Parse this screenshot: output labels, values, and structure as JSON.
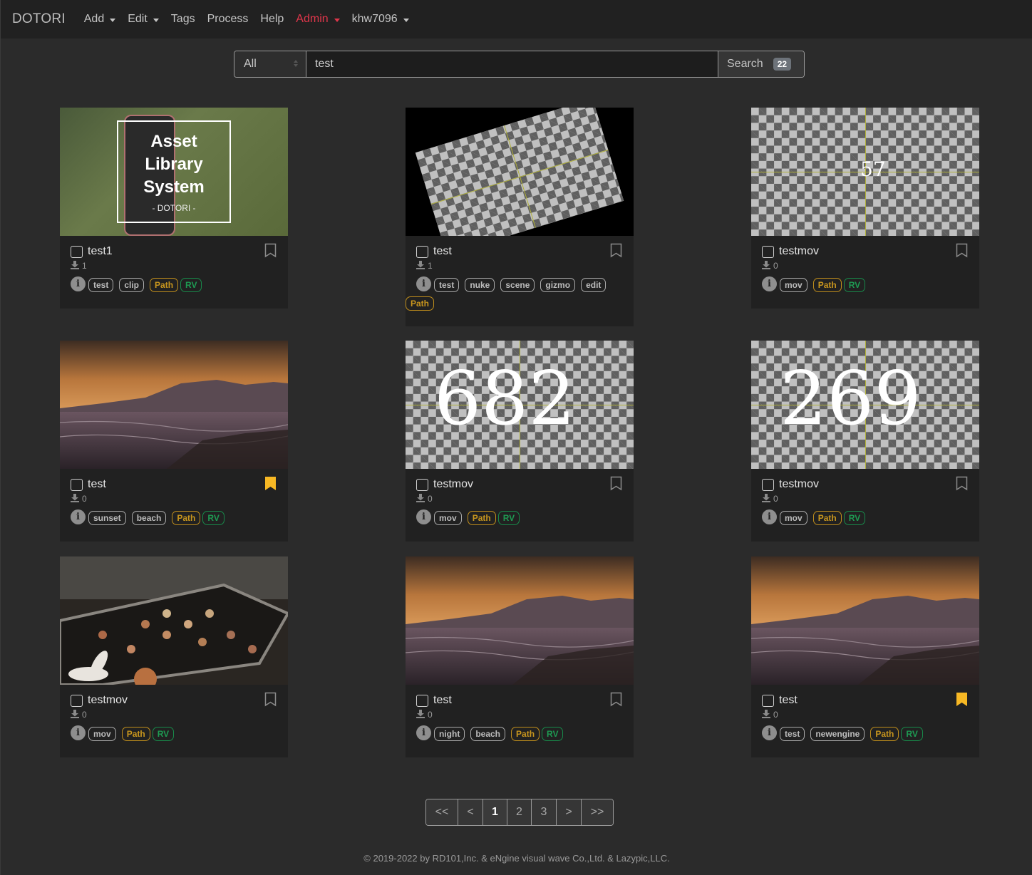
{
  "nav": {
    "brand": "DOTORI",
    "items": [
      {
        "label": "Add",
        "dropdown": true
      },
      {
        "label": "Edit",
        "dropdown": true
      },
      {
        "label": "Tags",
        "dropdown": false
      },
      {
        "label": "Process",
        "dropdown": false
      },
      {
        "label": "Help",
        "dropdown": false
      },
      {
        "label": "Admin",
        "dropdown": true,
        "color": "#e0364b"
      },
      {
        "label": "khw7096",
        "dropdown": true
      }
    ]
  },
  "search": {
    "scope": "All",
    "query": "test",
    "button_label": "Search",
    "result_count": "22"
  },
  "cards": [
    {
      "title": "test1",
      "downloads": "1",
      "bookmarked": false,
      "thumb": "Asset Library System poster",
      "thumb_text": [
        "Asset",
        "Library",
        "System",
        "- DOTORI -"
      ],
      "tags": [
        "test",
        "clip"
      ],
      "path": "Path",
      "rv": "RV"
    },
    {
      "title": "test",
      "downloads": "1",
      "bookmarked": false,
      "thumb": "rotated checkerboard",
      "tags": [
        "test",
        "nuke",
        "scene",
        "gizmo",
        "edit"
      ],
      "path": "Path",
      "rv": null
    },
    {
      "title": "testmov",
      "downloads": "0",
      "bookmarked": false,
      "thumb": "checkerboard frame",
      "frame_number": "57",
      "tags": [
        "mov"
      ],
      "path": "Path",
      "rv": "RV"
    },
    {
      "title": "test",
      "downloads": "0",
      "bookmarked": true,
      "thumb": "sunset beach",
      "tags": [
        "sunset",
        "beach"
      ],
      "path": "Path",
      "rv": "RV"
    },
    {
      "title": "testmov",
      "downloads": "0",
      "bookmarked": false,
      "thumb": "checkerboard frame",
      "frame_number": "682",
      "tags": [
        "mov"
      ],
      "path": "Path",
      "rv": "RV"
    },
    {
      "title": "testmov",
      "downloads": "0",
      "bookmarked": false,
      "thumb": "checkerboard frame",
      "frame_number": "269",
      "tags": [
        "mov"
      ],
      "path": "Path",
      "rv": "RV"
    },
    {
      "title": "testmov",
      "downloads": "0",
      "bookmarked": false,
      "thumb": "tray with bokeh lights",
      "tags": [
        "mov"
      ],
      "path": "Path",
      "rv": "RV"
    },
    {
      "title": "test",
      "downloads": "0",
      "bookmarked": false,
      "thumb": "sunset beach",
      "tags": [
        "night",
        "beach"
      ],
      "path": "Path",
      "rv": "RV"
    },
    {
      "title": "test",
      "downloads": "0",
      "bookmarked": true,
      "thumb": "sunset beach",
      "tags": [
        "test",
        "newengine"
      ],
      "path": "Path",
      "rv": "RV"
    }
  ],
  "pagination": {
    "items": [
      "<<",
      "<",
      "1",
      "2",
      "3",
      ">",
      ">>"
    ],
    "current": "1"
  },
  "footer": "© 2019-2022 by RD101,Inc. & eNgine visual wave Co.,Ltd. & Lazypic,LLC.",
  "colors": {
    "bookmark_active": "#f7b824",
    "path_tag": "#c8961e",
    "rv_tag": "#1e9a52",
    "admin": "#e0364b"
  }
}
